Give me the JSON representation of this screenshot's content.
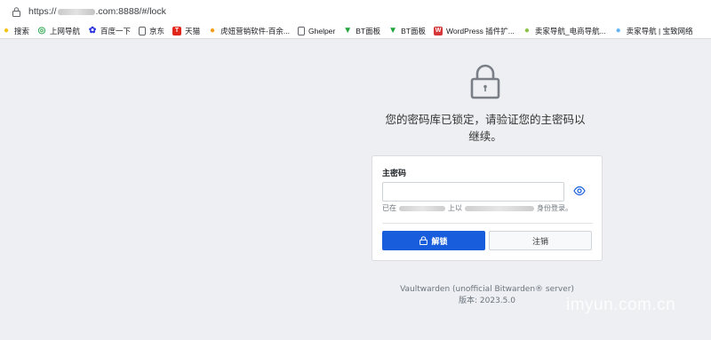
{
  "browser": {
    "url_prefix": "https://",
    "url_suffix": ".com:8888/#/lock"
  },
  "bookmarks": [
    {
      "label": "搜索",
      "icon": "circle-icon",
      "color": "#f5c211"
    },
    {
      "label": "上网导航",
      "icon": "globe-icon",
      "color": "#34a853"
    },
    {
      "label": "百度一下",
      "icon": "baidu-icon",
      "color": "#2932e1"
    },
    {
      "label": "京东",
      "icon": "page-icon",
      "color": "#5f6368"
    },
    {
      "label": "天猫",
      "icon": "tmall-icon",
      "color": "#e1251b"
    },
    {
      "label": "虎妞营销软件-百余...",
      "icon": "orange-icon",
      "color": "#f39c12"
    },
    {
      "label": "Ghelper",
      "icon": "page-icon",
      "color": "#5f6368"
    },
    {
      "label": "BT面板",
      "icon": "bt-icon",
      "color": "#20a53a"
    },
    {
      "label": "BT面板",
      "icon": "bt-icon",
      "color": "#20a53a"
    },
    {
      "label": "WordPress 插件扩...",
      "icon": "wp-icon",
      "color": "#d63638"
    },
    {
      "label": "卖家导航_电商导航...",
      "icon": "circle-icon",
      "color": "#8bc34a"
    },
    {
      "label": "卖家导航 | 宝致网络",
      "icon": "circle-icon",
      "color": "#64b5f6"
    }
  ],
  "lock": {
    "message": "您的密码库已锁定，请验证您的主密码以继续。"
  },
  "form": {
    "label": "主密码",
    "password_value": "",
    "login_prefix": "已在",
    "login_middle": "上以",
    "login_suffix": "身份登录。",
    "unlock_label": "解锁",
    "logout_label": "注销"
  },
  "footer": {
    "line1": "Vaultwarden (unofficial Bitwarden® server)",
    "line2": "版本: 2023.5.0"
  },
  "watermark": "imyun.com.cn",
  "colors": {
    "primary": "#175ddc",
    "background": "#edeff2"
  }
}
